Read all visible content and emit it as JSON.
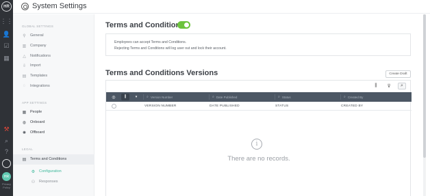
{
  "rail": {
    "logo": "HR",
    "avatar": "HR",
    "bottom_text": "Privacy Policy"
  },
  "header": {
    "title": "System Settings"
  },
  "sidebar": {
    "global_heading": "GLOBAL SETTINGS",
    "global_items": [
      {
        "label": "General",
        "icon": "wrench-icon"
      },
      {
        "label": "Company",
        "icon": "building-icon"
      },
      {
        "label": "Notifications",
        "icon": "bell-icon"
      },
      {
        "label": "Import",
        "icon": "import-icon"
      },
      {
        "label": "Templates",
        "icon": "template-icon"
      },
      {
        "label": "Integrations",
        "icon": "integrations-icon"
      }
    ],
    "app_heading": "APP SETTINGS",
    "app_items": [
      {
        "label": "People",
        "icon": "people-icon"
      },
      {
        "label": "Onboard",
        "icon": "onboard-icon"
      },
      {
        "label": "Offboard",
        "icon": "offboard-icon"
      }
    ],
    "legal_heading": "LEGAL",
    "legal_item": "Terms and Conditions",
    "legal_sub": [
      {
        "label": "Configuration",
        "active": true
      },
      {
        "label": "Responses",
        "active": false
      }
    ]
  },
  "main": {
    "title": "Terms and Conditions",
    "toggle_on": true,
    "info_line1": "Employees can accept Terms and Conditions.",
    "info_line2": "Rejecting Terms and Conditions will log user out and lock their account.",
    "versions_title": "Terms and Conditions Versions",
    "create_draft": "Create Draft",
    "filters": {
      "version_placeholder": "Version Number",
      "date_placeholder": "Date Published",
      "status_placeholder": "Status",
      "created_placeholder": "Created By"
    },
    "columns": [
      "VERSION NUMBER",
      "DATE PUBLISHED",
      "STATUS",
      "CREATED BY"
    ],
    "empty_text": "There are no records."
  },
  "colors": {
    "accent": "#3bb89a",
    "toggle": "#6cc33c",
    "rail": "#2f3237",
    "filterbar": "#4c5764"
  }
}
